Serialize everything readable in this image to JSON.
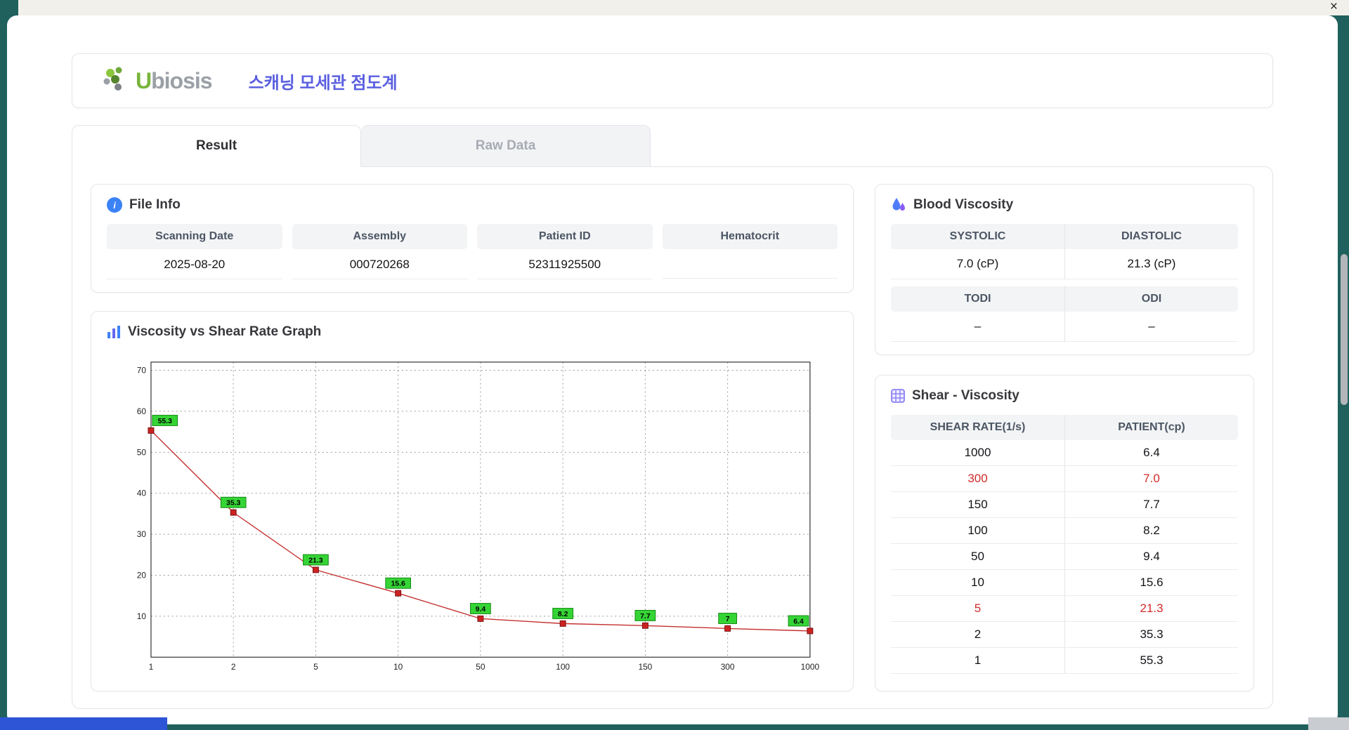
{
  "window": {
    "close_glyph": "×"
  },
  "header": {
    "brand_initial": "U",
    "brand_rest": "biosis",
    "title": "스캐닝 모세관 점도계"
  },
  "tabs": {
    "result": "Result",
    "raw_data": "Raw Data"
  },
  "icons": {
    "info_glyph": "i"
  },
  "file_info": {
    "title": "File Info",
    "fields": [
      {
        "label": "Scanning Date",
        "value": "2025-08-20"
      },
      {
        "label": "Assembly",
        "value": "000720268"
      },
      {
        "label": "Patient ID",
        "value": "52311925500"
      },
      {
        "label": "Hematocrit",
        "value": ""
      }
    ]
  },
  "blood_viscosity": {
    "title": "Blood Viscosity",
    "header_row1": [
      "SYSTOLIC",
      "DIASTOLIC"
    ],
    "value_row1": [
      "7.0 (cP)",
      "21.3 (cP)"
    ],
    "header_row2": [
      "TODI",
      "ODI"
    ],
    "value_row2": [
      "–",
      "–"
    ]
  },
  "shear_viscosity": {
    "title": "Shear - Viscosity",
    "col1": "SHEAR RATE(1/s)",
    "col2": "PATIENT(cp)",
    "rows": [
      {
        "shear": "1000",
        "patient": "6.4",
        "variant": "normal"
      },
      {
        "shear": "300",
        "patient": "7.0",
        "variant": "red"
      },
      {
        "shear": "150",
        "patient": "7.7",
        "variant": "normal"
      },
      {
        "shear": "100",
        "patient": "8.2",
        "variant": "normal"
      },
      {
        "shear": "50",
        "patient": "9.4",
        "variant": "normal"
      },
      {
        "shear": "10",
        "patient": "15.6",
        "variant": "normal"
      },
      {
        "shear": "5",
        "patient": "21.3",
        "variant": "red"
      },
      {
        "shear": "2",
        "patient": "35.3",
        "variant": "normal"
      },
      {
        "shear": "1",
        "patient": "55.3",
        "variant": "normal"
      }
    ]
  },
  "chart_data": {
    "type": "line",
    "title": "Viscosity vs Shear Rate Graph",
    "xlabel": "",
    "ylabel": "",
    "x_scale": "categorical",
    "x": [
      "1",
      "2",
      "5",
      "10",
      "50",
      "100",
      "150",
      "300",
      "1000"
    ],
    "values": [
      55.3,
      35.3,
      21.3,
      15.6,
      9.4,
      8.2,
      7.7,
      7,
      6.4
    ],
    "point_labels": [
      "55.3",
      "35.3",
      "21.3",
      "15.6",
      "9.4",
      "8.2",
      "7.7",
      "7",
      "6.4"
    ],
    "ylim": [
      0,
      72
    ],
    "yticks": [
      10,
      20,
      30,
      40,
      50,
      60,
      70
    ],
    "grid": true,
    "line_color": "#c43030",
    "marker_color": "#cc2222",
    "marker_edge": "#7a0f0f",
    "label_bg": "#35d435",
    "label_edge": "#128a12"
  }
}
